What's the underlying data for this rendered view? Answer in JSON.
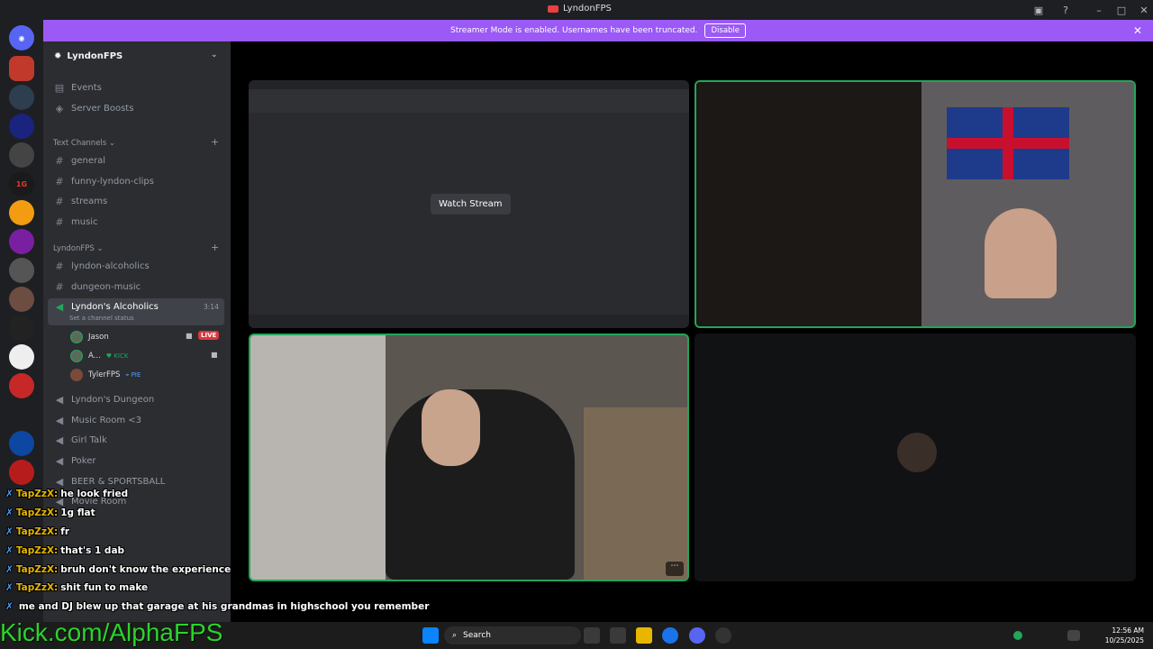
{
  "window": {
    "title": "LyndonFPS"
  },
  "banner": {
    "text": "Streamer Mode is enabled. Usernames have been truncated.",
    "button": "Disable"
  },
  "server": {
    "name": "LyndonFPS"
  },
  "sidebar": {
    "top_items": [
      "Events",
      "Server Boosts"
    ],
    "cat1": "Text Channels",
    "text_channels": [
      "general",
      "funny-lyndon-clips",
      "streams",
      "music"
    ],
    "cat2": "LyndonFPS",
    "channels2": [
      "lyndon-alcoholics",
      "dungeon-music"
    ],
    "active_voice": {
      "name": "Lyndon's Alcoholics",
      "status": "Set a channel status",
      "time": "3:14"
    },
    "voice_users": [
      {
        "name": "Jason",
        "badge": "LIVE"
      },
      {
        "name": "A...",
        "badge": "KICK"
      },
      {
        "name": "TylerFPS",
        "badge": "PIE"
      }
    ],
    "voice_channels": [
      "Lyndon's Dungeon",
      "Music Room <3",
      "Girl Talk",
      "Poker",
      "BEER & SPORTSBALL",
      "Movie Room"
    ]
  },
  "main": {
    "watch_button": "Watch Stream"
  },
  "chat": [
    {
      "user": "TapZzX:",
      "msg": "he look fried"
    },
    {
      "user": "TapZzX:",
      "msg": "1g flat"
    },
    {
      "user": "TapZzX:",
      "msg": "fr"
    },
    {
      "user": "TapZzX:",
      "msg": "that's 1 dab"
    },
    {
      "user": "TapZzX:",
      "msg": "bruh don't know the experience"
    },
    {
      "user": "TapZzX:",
      "msg": "shit fun to make"
    },
    {
      "user": "",
      "msg": "me and DJ blew up that garage at his grandmas in highschool you remember"
    }
  ],
  "brand": "Kick.com/AlphaFPS",
  "taskbar": {
    "search": "Search",
    "time": "12:56 AM",
    "date": "10/25/2025"
  }
}
